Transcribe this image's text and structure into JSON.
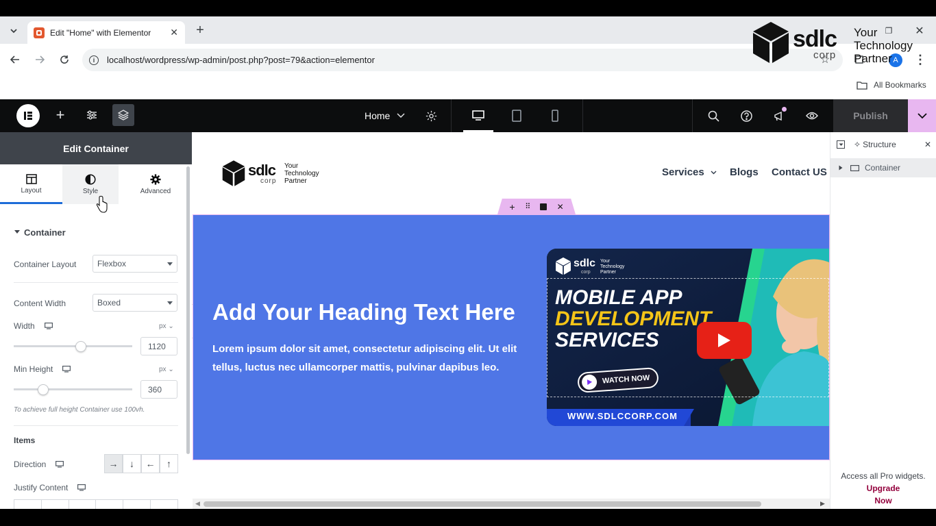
{
  "browser": {
    "tab_title": "Edit \"Home\" with Elementor",
    "url": "localhost/wordpress/wp-admin/post.php?post=79&action=elementor",
    "bookmarks_label": "All Bookmarks",
    "profile_initial": "A"
  },
  "watermark": {
    "logo_text": "sdlc",
    "logo_sub": "corp",
    "tagline": [
      "Your",
      "Technology",
      "Partner"
    ]
  },
  "topbar": {
    "page_name": "Home",
    "publish_label": "Publish"
  },
  "panel": {
    "title": "Edit Container",
    "tabs": [
      {
        "label": "Layout"
      },
      {
        "label": "Style"
      },
      {
        "label": "Advanced"
      }
    ],
    "section_title": "Container",
    "container_layout_label": "Container Layout",
    "container_layout_value": "Flexbox",
    "content_width_label": "Content Width",
    "content_width_value": "Boxed",
    "width_label": "Width",
    "width_unit": "px",
    "width_value": "1120",
    "min_height_label": "Min Height",
    "min_height_unit": "px",
    "min_height_value": "360",
    "hint": "To achieve full height Container use 100vh.",
    "items_title": "Items",
    "direction_label": "Direction",
    "justify_label": "Justify Content"
  },
  "site": {
    "logo_text": "sdlc",
    "logo_sub": "corp",
    "logo_tagline": [
      "Your",
      "Technology",
      "Partner"
    ],
    "nav": [
      "Services",
      "Blogs",
      "Contact US"
    ],
    "hero_heading": "Add Your Heading Text Here",
    "hero_paragraph_1": "Lorem ipsum dolor sit amet, consectetur adipiscing elit. Ut elit",
    "hero_paragraph_2": "tellus, luctus nec ullamcorper mattis, pulvinar dapibus leo."
  },
  "banner": {
    "logo_text": "sdlc",
    "logo_sub": "corp",
    "tagline": [
      "Your",
      "Technology",
      "Partner"
    ],
    "line1": "MOBILE APP",
    "line2": "DEVELOPMENT",
    "line3": "SERVICES",
    "watch": "WATCH NOW",
    "url": "WWW.SDLCCORP.COM"
  },
  "structure": {
    "title": "Structure",
    "item": "Container",
    "promo_text": "Access all Pro widgets.",
    "promo_link_1": "Upgrade",
    "promo_link_2": "Now"
  },
  "colors": {
    "hero_bg": "#4f76e6",
    "accent_pink": "#e8b7f0",
    "elementor_dark": "#0c0d0e",
    "upgrade_link": "#93003c"
  }
}
